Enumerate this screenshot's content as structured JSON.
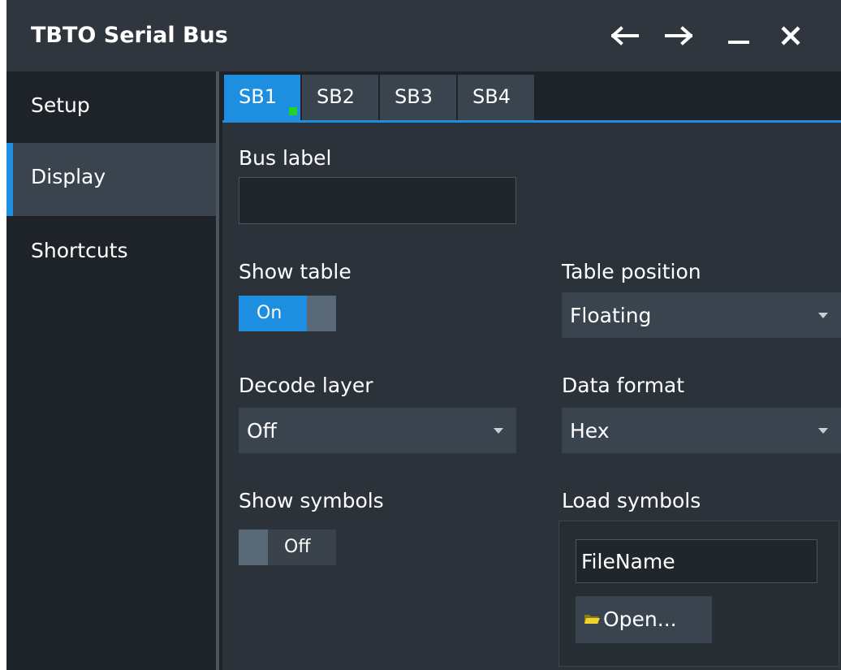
{
  "window": {
    "title": "TBTO Serial Bus",
    "controls": [
      "arrow-left-icon",
      "arrow-right-icon",
      "minimize-icon",
      "close-icon"
    ]
  },
  "sidebar": {
    "items": [
      {
        "label": "Setup",
        "active": false
      },
      {
        "label": "Display",
        "active": true
      },
      {
        "label": "Shortcuts",
        "active": false
      }
    ]
  },
  "tabs": [
    {
      "label": "SB1",
      "active": true,
      "indicator": "green-square"
    },
    {
      "label": "SB2",
      "active": false
    },
    {
      "label": "SB3",
      "active": false
    },
    {
      "label": "SB4",
      "active": false
    }
  ],
  "form": {
    "bus_label": {
      "label": "Bus label",
      "value": ""
    },
    "show_table": {
      "label": "Show table",
      "state": "On"
    },
    "table_position": {
      "label": "Table position",
      "value": "Floating"
    },
    "decode_layer": {
      "label": "Decode layer",
      "value": "Off"
    },
    "data_format": {
      "label": "Data format",
      "value": "Hex"
    },
    "show_symbols": {
      "label": "Show symbols",
      "state": "Off"
    },
    "load_symbols": {
      "label": "Load symbols",
      "filename": "FileName",
      "open_label": "Open..."
    }
  },
  "colors": {
    "accent": "#1e8fe0",
    "indicator": "#22d12a",
    "background": "#2b3239",
    "sidebar": "#1d2329"
  }
}
